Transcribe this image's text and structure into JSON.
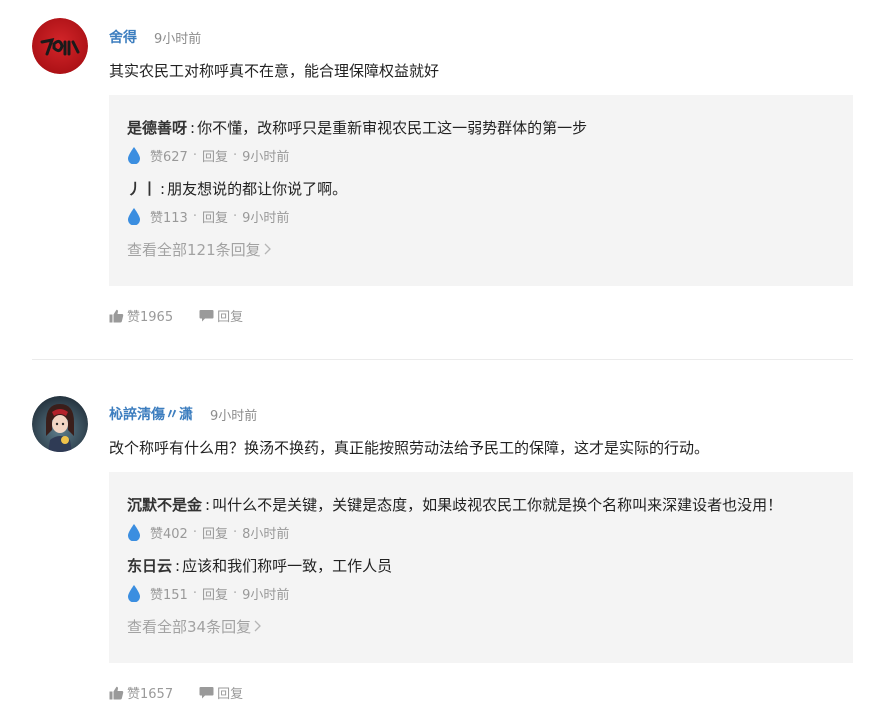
{
  "comments": [
    {
      "author": "舍得",
      "time": "9小时前",
      "text": "其实农民工对称呼真不在意，能合理保障权益就好",
      "avatar_icon": "red-calligraphy-avatar",
      "replies": [
        {
          "user": "是德善呀",
          "text": "你不懂，改称呼只是重新审视农民工这一弱势群体的第一步",
          "likes": "赞627",
          "reply_label": "回复",
          "time": "9小时前"
        },
        {
          "user": "丿丨",
          "text": "朋友想说的都让你说了啊。",
          "likes": "赞113",
          "reply_label": "回复",
          "time": "9小时前"
        }
      ],
      "view_all": "查看全部121条回复",
      "like_count": "赞1965",
      "reply_label": "回复"
    },
    {
      "author": "杺誶淸傷〃潇",
      "time": "9小时前",
      "text": "改个称呼有什么用？换汤不换药，真正能按照劳动法给予民工的保障，这才是实际的行动。",
      "avatar_icon": "anime-girl-avatar",
      "replies": [
        {
          "user": "沉默不是金",
          "text": "叫什么不是关键，关键是态度，如果歧视农民工你就是换个名称叫来深建设者也没用！",
          "likes": "赞402",
          "reply_label": "回复",
          "time": "8小时前"
        },
        {
          "user": "东日云",
          "text": "应该和我们称呼一致，工作人员",
          "likes": "赞151",
          "reply_label": "回复",
          "time": "9小时前"
        }
      ],
      "view_all": "查看全部34条回复",
      "like_count": "赞1657",
      "reply_label": "回复"
    }
  ],
  "colors": {
    "author": "#3d7ebf",
    "drop": "#3b8ee0",
    "reply_box_bg": "#f4f4f4",
    "muted": "#999999"
  }
}
